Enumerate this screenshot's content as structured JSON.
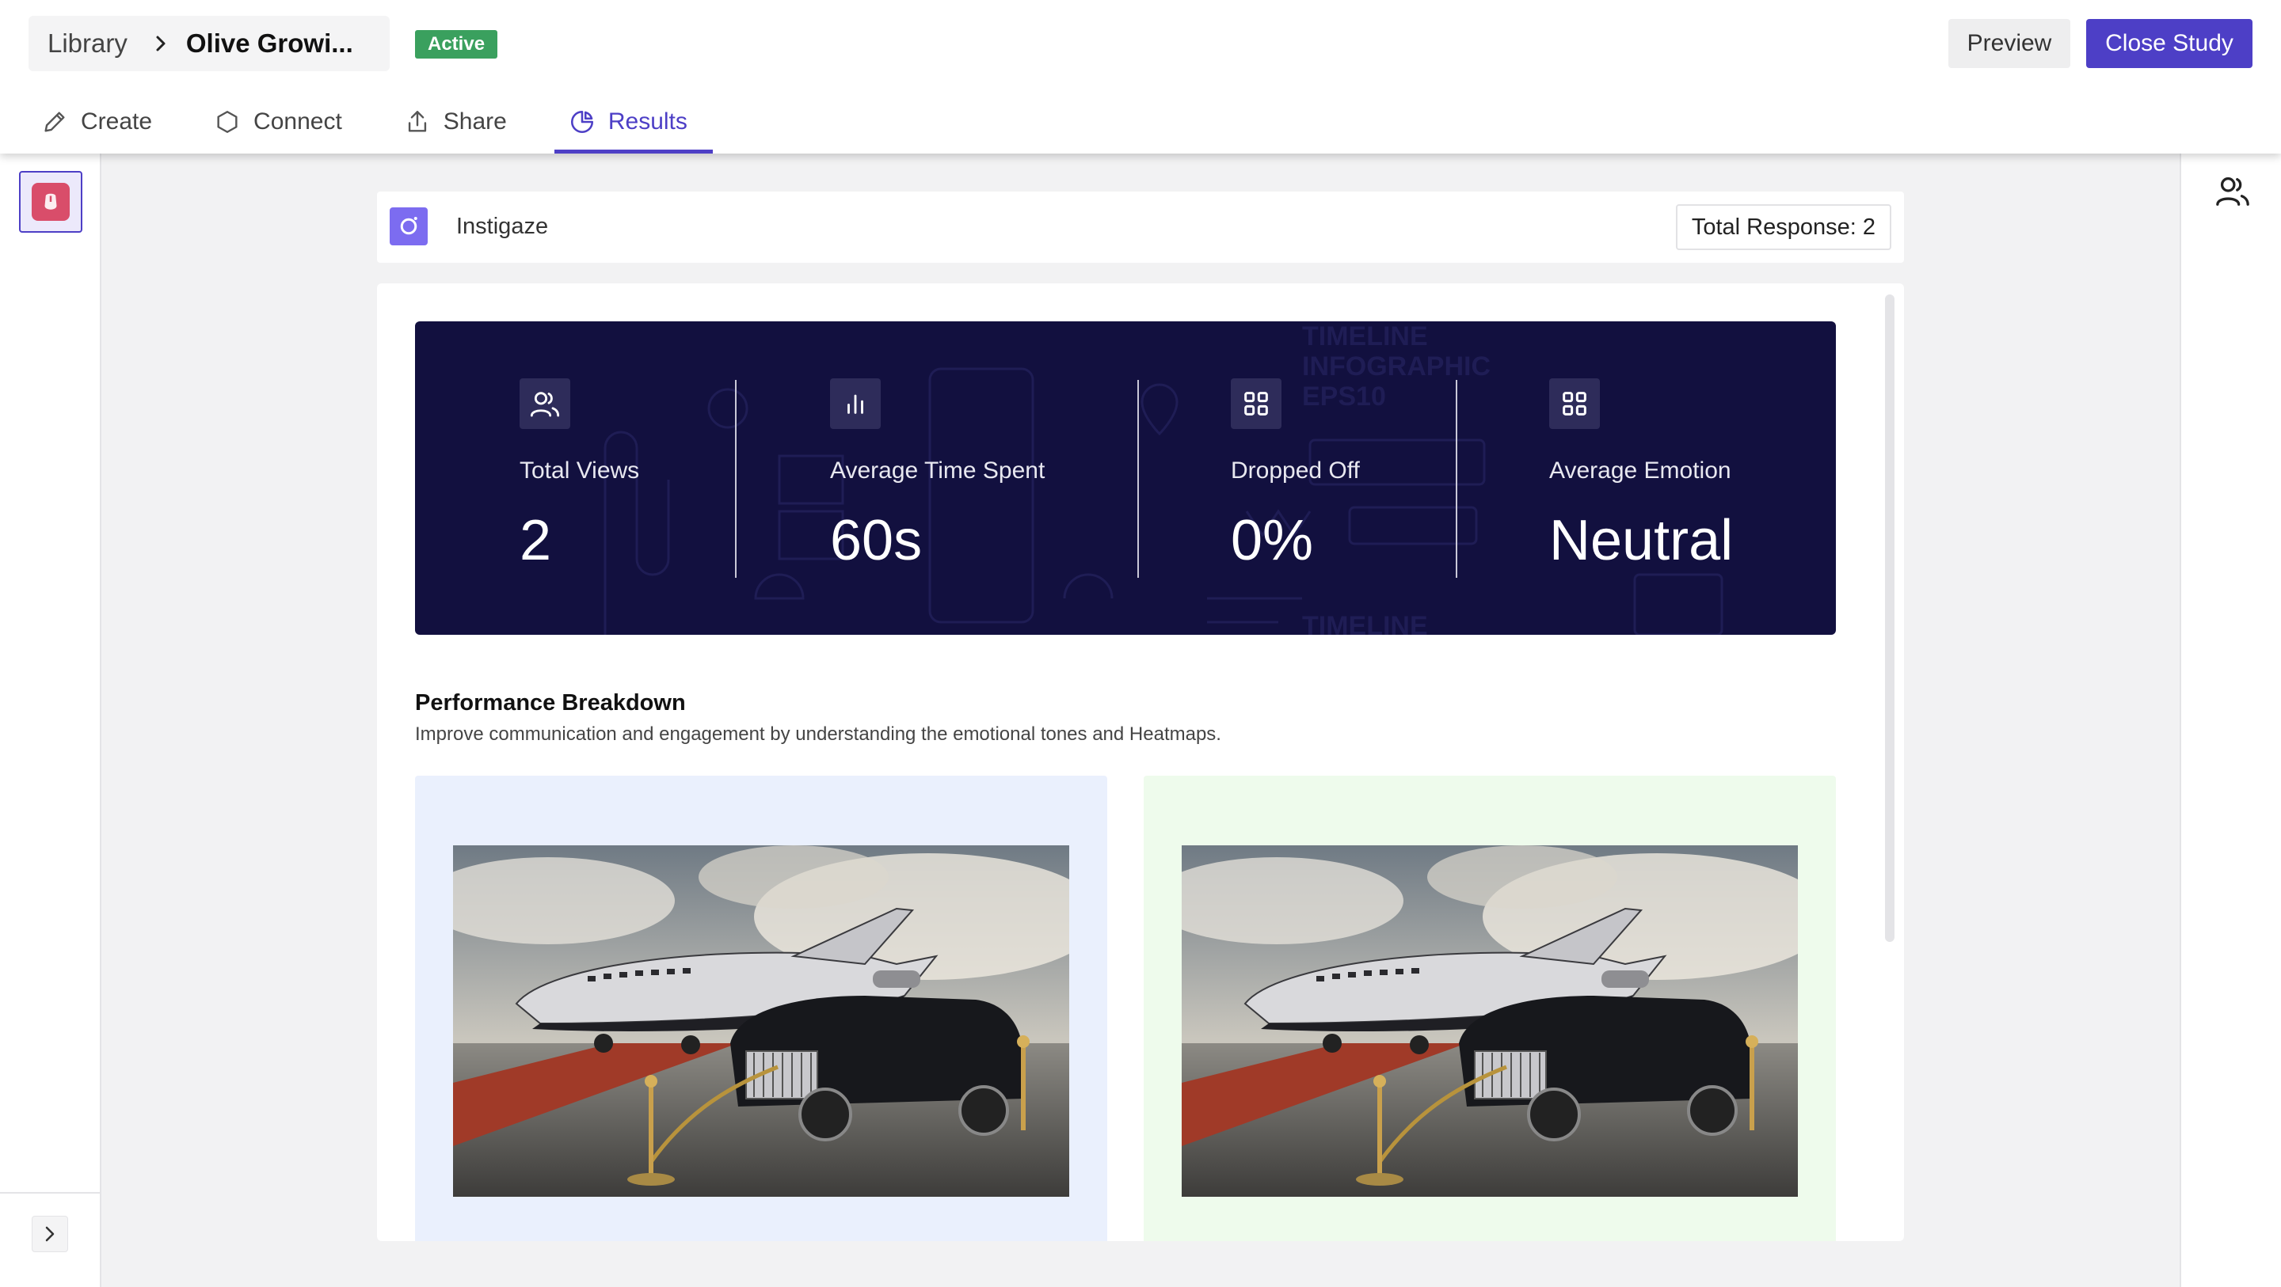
{
  "header": {
    "breadcrumb": {
      "library": "Library",
      "current": "Olive Growi..."
    },
    "status": "Active",
    "preview_label": "Preview",
    "close_label": "Close Study",
    "tabs": [
      {
        "label": "Create",
        "icon": "pencil-icon"
      },
      {
        "label": "Connect",
        "icon": "hexagon-icon"
      },
      {
        "label": "Share",
        "icon": "share-icon"
      },
      {
        "label": "Results",
        "icon": "pie-chart-icon",
        "active": true
      }
    ]
  },
  "study": {
    "name": "Instigaze",
    "total_response": "Total Response: 2"
  },
  "stats": [
    {
      "label": "Total Views",
      "value": "2",
      "icon": "users-icon"
    },
    {
      "label": "Average Time Spent",
      "value": "60s",
      "icon": "bar-chart-icon"
    },
    {
      "label": "Dropped Off",
      "value": "0%",
      "icon": "grid-icon"
    },
    {
      "label": "Average Emotion",
      "value": "Neutral",
      "icon": "grid-icon"
    }
  ],
  "performance": {
    "title": "Performance Breakdown",
    "description": "Improve communication and engagement by understanding the emotional tones and Heatmaps."
  },
  "colors": {
    "accent": "#4d3fc6",
    "active_badge": "#3aa05e",
    "stats_banner": "#12103f",
    "card_blue": "#eaf0fd",
    "card_green": "#eefbec"
  }
}
